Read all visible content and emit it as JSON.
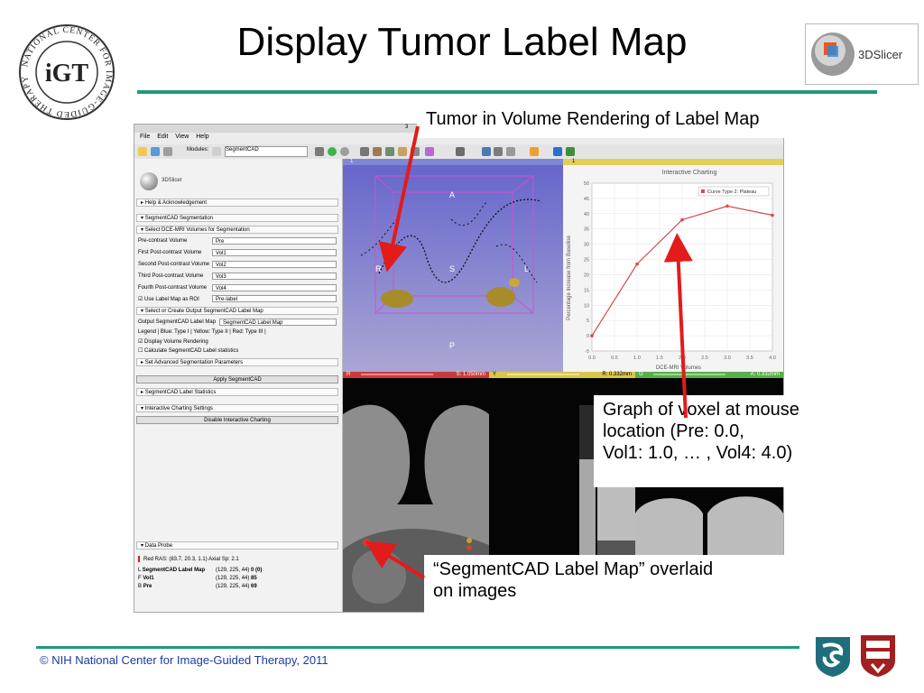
{
  "slide": {
    "title": "Display Tumor Label Map",
    "footer": "© NIH National Center for Image-Guided Therapy, 2011",
    "igt_logo_text": "NATIONAL CENTER FOR IMAGE-GUIDED THERAPY",
    "slicer_logo_text": "3DSlicer",
    "accent_color": "#1f9a7c",
    "footer_color": "#1b3aa0",
    "arrow_color": "#e31b1b"
  },
  "callouts": {
    "volume_rendering": "Tumor in Volume Rendering of Label Map",
    "graph_line1": "Graph of voxel at mouse",
    "graph_line2": "location (Pre: 0.0,",
    "graph_line3": "Vol1: 1.0, … , Vol4: 4.0)",
    "overlay_line1": "“SegmentCAD Label Map” overlaid",
    "overlay_line2": "on images"
  },
  "app": {
    "window_title": "3",
    "menu": [
      "File",
      "Edit",
      "View",
      "Help"
    ],
    "modules_label": "Modules:",
    "module_selected": "SegmentCAD",
    "logo": "3DSlicer",
    "sections": {
      "help": "Help & Acknowledgement",
      "segmentation": "SegmentCAD Segmentation",
      "select_volumes": "Select DCE-MRI Volumes for Segmentation",
      "select_output": "Select or Create Output SegmentCAD Label Map",
      "advanced": "Set Advanced Segmentation Parameters",
      "statistics": "SegmentCAD Label Statistics",
      "charting": "Interactive Charting Settings",
      "data_probe": "Data Probe"
    },
    "fields": {
      "pre_label": "Pre-contrast Volume",
      "pre_value": "Pre",
      "first_label": "First Post-contrast Volume",
      "first_value": "Vol1",
      "second_label": "Second Post-contrast Volume",
      "second_value": "Vol2",
      "third_label": "Third Post-contrast Volume",
      "third_value": "Vol3",
      "fourth_label": "Fourth Post-contrast Volume",
      "fourth_value": "Vol4",
      "roi_label": "Use Label Map as ROI",
      "roi_value": "Pre-label",
      "output_label": "Output SegmentCAD Label Map",
      "output_value": "SegmentCAD Label Map",
      "legend": "Legend | Blue: Type I | Yellow: Type II | Red: Type III |",
      "display_vr": "Display Volume Rendering",
      "calc_stats": "Calculate SegmentCAD Label statistics"
    },
    "buttons": {
      "apply": "Apply SegmentCAD",
      "disable_chart": "Disable Interactive Charting"
    },
    "probe": {
      "header": "Red   RAS: (83.7, 20.3, 1.1)   Axial  Sp: 2.1",
      "rows": [
        {
          "prefix": "L",
          "name": "SegmentCAD Label Map",
          "ijk": "(129, 225, 44)",
          "value": "0 (0)"
        },
        {
          "prefix": "F",
          "name": "Vol1",
          "ijk": "(129, 225, 44)",
          "value": "85"
        },
        {
          "prefix": "B",
          "name": "Pre",
          "ijk": "(129, 225, 44)",
          "value": "69"
        }
      ]
    },
    "view3d": {
      "header": "1",
      "labels": {
        "A": "A",
        "R": "R",
        "S": "S",
        "L": "L",
        "P": "P"
      }
    },
    "slices": {
      "red": {
        "tag": "R",
        "value": "S: 1.050mm"
      },
      "yellow": {
        "tag": "Y",
        "value": "R: 0.332mm"
      },
      "green": {
        "tag": "G",
        "value": "A: 0.332mm"
      }
    },
    "chart_header": "1"
  },
  "chart_data": {
    "type": "line",
    "title": "Interactive Charting",
    "xlabel": "DCE-MRI Volumes",
    "ylabel": "Percentage Increase from Baseline",
    "xlim": [
      0,
      4.0
    ],
    "ylim": [
      -5,
      50
    ],
    "xticks": [
      "0.0",
      "0.5",
      "1.0",
      "1.5",
      "2.0",
      "2.5",
      "3.0",
      "3.5",
      "4.0"
    ],
    "yticks": [
      "-5",
      "0",
      "5",
      "10",
      "15",
      "20",
      "25",
      "30",
      "35",
      "40",
      "45",
      "50"
    ],
    "legend": "top-right",
    "series": [
      {
        "name": "Curve Type 2: Plateau",
        "color": "#d24b4b",
        "x": [
          0,
          1,
          2,
          3,
          4
        ],
        "y": [
          0,
          23.5,
          38,
          42.5,
          39.5
        ]
      }
    ]
  }
}
